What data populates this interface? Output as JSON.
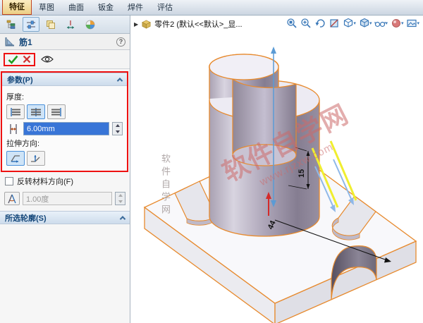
{
  "command_tabs": [
    {
      "label": "特征",
      "active": true
    },
    {
      "label": "草图",
      "active": false
    },
    {
      "label": "曲面",
      "active": false
    },
    {
      "label": "钣金",
      "active": false
    },
    {
      "label": "焊件",
      "active": false
    },
    {
      "label": "评估",
      "active": false
    }
  ],
  "property_panel": {
    "title": "筋1",
    "help_symbol": "?",
    "parameters": {
      "header": "参数(P)",
      "thickness_label": "厚度:",
      "thickness_value": "6.00mm",
      "direction_label": "拉伸方向:",
      "flip_material_label": "反转材料方向(F)",
      "draft_value": "1.00度"
    },
    "selected_contours_header": "所选轮廓(S)"
  },
  "viewport": {
    "flyout_arrow": "▶",
    "tree_header": "零件2 (默认<<默认>_显...",
    "dimensions": {
      "rib_width": "15",
      "base_distance": "44"
    },
    "watermark": {
      "line1": "软件自学网",
      "line2": "www.rjzxw.com",
      "side_vertical": "软件自学网"
    }
  },
  "colors": {
    "edge_highlight_orange": "#e78a2e",
    "selection_blue": "#3875d7",
    "annotation_red": "#ee1111",
    "rib_preview_yellow": "#f0ee30",
    "direction_arrow_blue": "#8fb8e8"
  }
}
